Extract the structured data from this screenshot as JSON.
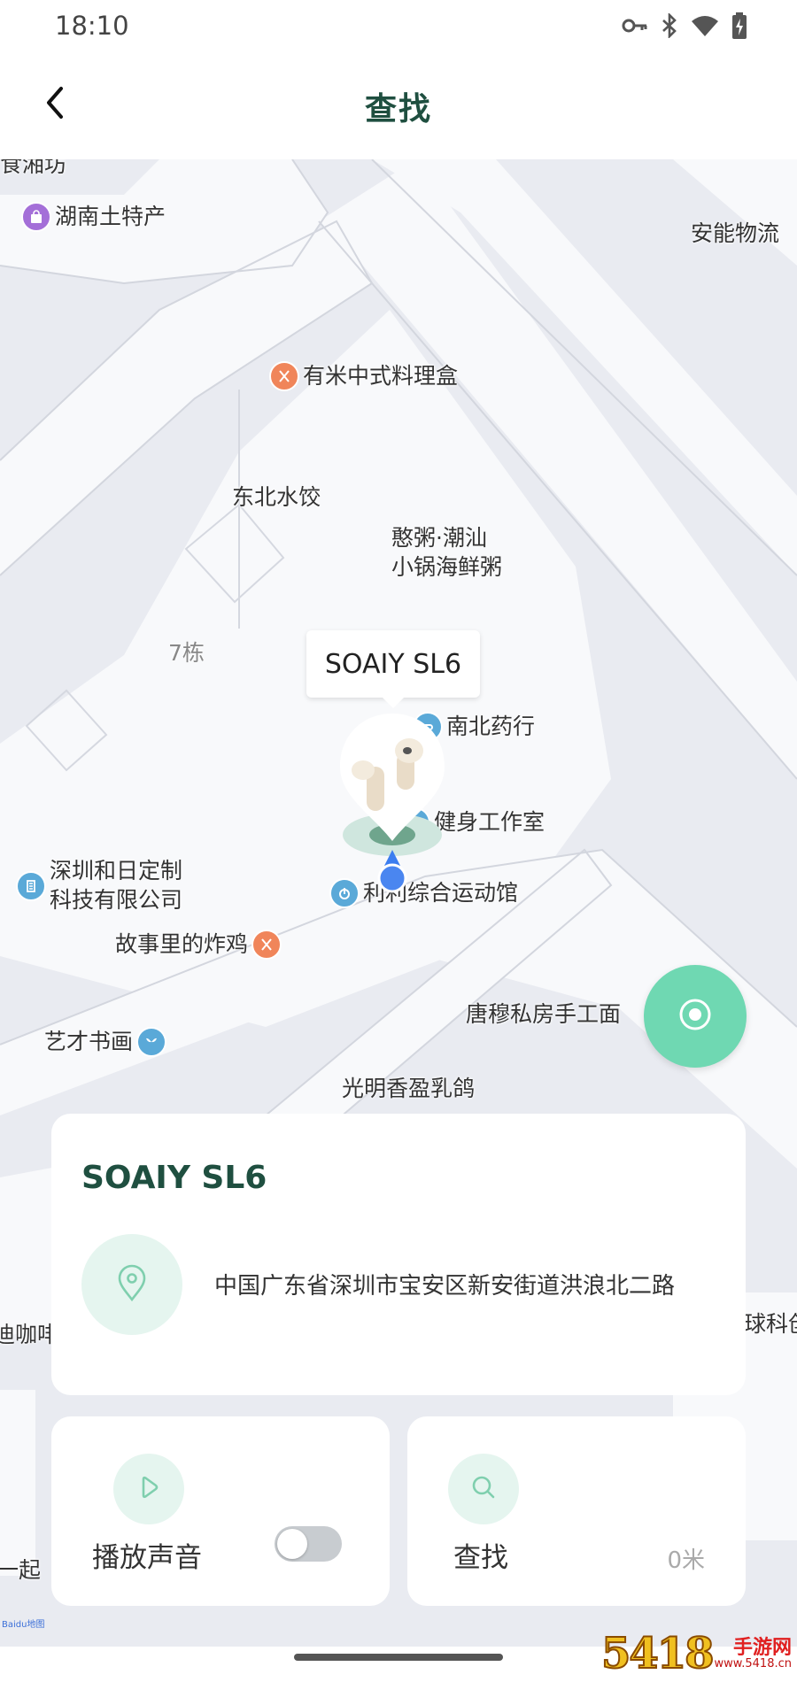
{
  "status_bar": {
    "time": "18:10",
    "icons": [
      "key-icon",
      "bluetooth-icon",
      "wifi-icon",
      "battery-icon"
    ]
  },
  "header": {
    "title": "查找",
    "back_icon": "chevron-left-icon"
  },
  "map": {
    "pois": [
      {
        "id": "poi-top-left",
        "label": "食湘坊",
        "icon": ""
      },
      {
        "id": "poi-hunan",
        "label": "湖南土特产",
        "icon": "shopping-bag-icon",
        "color": "#a46fd8"
      },
      {
        "id": "poi-anneng",
        "label": "安能物流",
        "icon": ""
      },
      {
        "id": "poi-youmi",
        "label": "有米中式料理盒",
        "icon": "fork-knife-icon",
        "color": "#f0855a"
      },
      {
        "id": "poi-dongbei",
        "label": "东北水饺",
        "icon": ""
      },
      {
        "id": "poi-hanzhou",
        "label": [
          "憨粥·潮汕",
          "小锅海鲜粥"
        ],
        "icon": ""
      },
      {
        "id": "poi-7dong",
        "label": "7栋",
        "icon": ""
      },
      {
        "id": "poi-nanbei",
        "label": "南北药行",
        "icon": "pill-icon",
        "color": "#5aa9d8"
      },
      {
        "id": "poi-jianshen",
        "label": "健身工作室",
        "icon": "dumbbell-icon",
        "color": "#5aa9d8"
      },
      {
        "id": "poi-heri",
        "label": [
          "深圳和日定制",
          "科技有限公司"
        ],
        "icon": "building-icon",
        "color": "#5aa9d8"
      },
      {
        "id": "poi-yundong",
        "label": "利利综合运动馆",
        "icon": "sports-icon",
        "color": "#5aa9d8"
      },
      {
        "id": "poi-zhaji",
        "label": "故事里的炸鸡",
        "icon": "fork-knife-icon",
        "color": "#f0855a"
      },
      {
        "id": "poi-tangmu",
        "label": "唐穆私房手工面",
        "icon": ""
      },
      {
        "id": "poi-yicai",
        "label": "艺才书画",
        "icon": "leaf-icon",
        "color": "#5aa9d8"
      },
      {
        "id": "poi-guangming",
        "label": "光明香盈乳鸽",
        "icon": ""
      },
      {
        "id": "poi-coffee",
        "label": "迪咖啡",
        "icon": ""
      },
      {
        "id": "poi-tech",
        "label": "球科创",
        "icon": ""
      },
      {
        "id": "poi-yiqi",
        "label": "一起",
        "icon": ""
      }
    ],
    "device_callout": "SOAIY SL6",
    "map_logo": "Baidu地图",
    "locate_icon": "locate-target-icon"
  },
  "device_card": {
    "name": "SOAIY SL6",
    "location_icon": "location-pin-icon",
    "address": "中国广东省深圳市宝安区新安街道洪浪北二路"
  },
  "actions": {
    "play_sound": {
      "label": "播放声音",
      "icon": "play-icon",
      "toggle_on": false
    },
    "find": {
      "label": "查找",
      "icon": "search-icon",
      "distance": "0米"
    }
  },
  "watermark": {
    "number": "5418",
    "brand": "手游网",
    "url": "www.5418.cn"
  },
  "colors": {
    "accent": "#6fd8b2",
    "title_green": "#1f4f40",
    "soft_green": "#e5f5ef",
    "map_bg": "#e9ebf1"
  }
}
